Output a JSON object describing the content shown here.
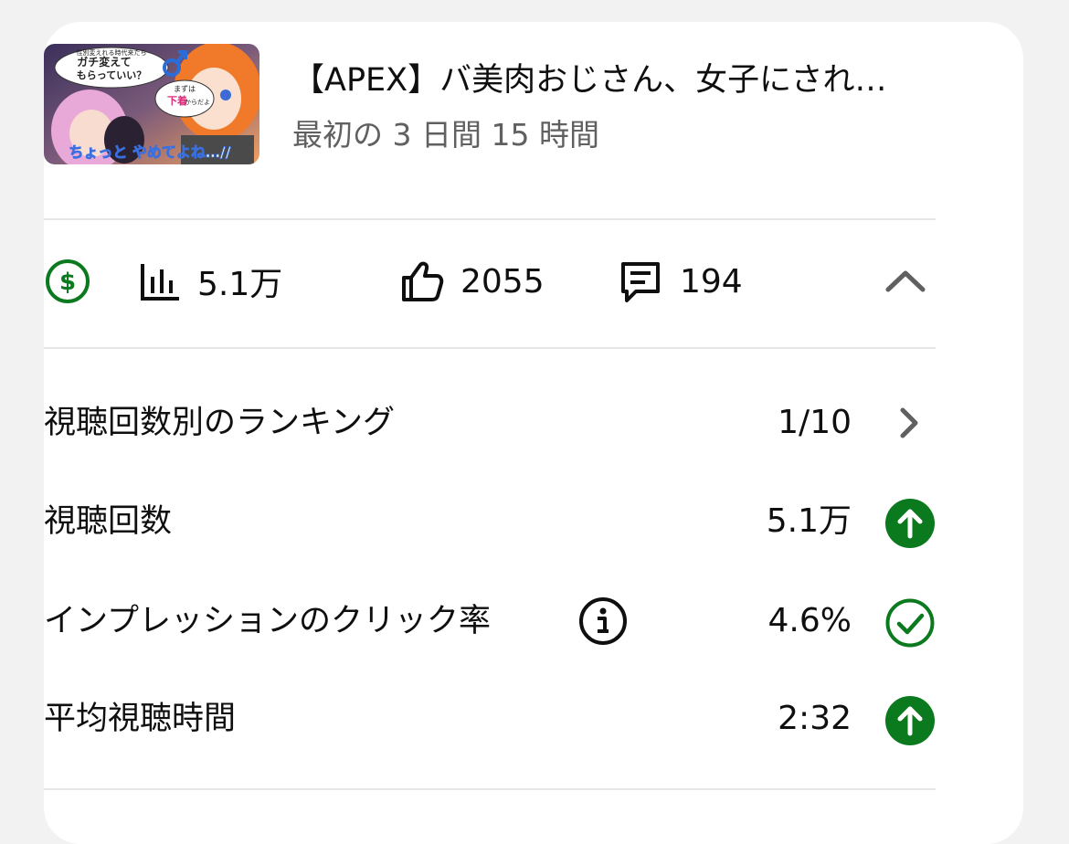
{
  "video": {
    "title": "【APEX】バ美肉おじさん、女子にされ…",
    "period": "最初の 3 日間 15 時間",
    "thumbnail": {
      "caption_top": "性別変えれる時代来たら",
      "caption_mid": "ガチ変えて",
      "caption_mid2": "もらっていい？",
      "caption_right": "まずは",
      "caption_right2": "下着",
      "caption_right3": "からだよ",
      "caption_bottom": "ちょっと やめてよね…//"
    }
  },
  "stats": {
    "monetization_icon": "dollar-circle-icon",
    "views": "5.1万",
    "likes": "2055",
    "comments": "194"
  },
  "metrics": [
    {
      "label": "視聴回数別のランキング",
      "value": "1/10",
      "status_icon": "chevron-right-icon"
    },
    {
      "label": "視聴回数",
      "value": "5.1万",
      "status_icon": "up-arrow-circle-icon"
    },
    {
      "label": "インプレッションのクリック率",
      "value": "4.6%",
      "status_icon": "check-circle-icon"
    },
    {
      "label": "平均視聴時間",
      "value": "2:32",
      "status_icon": "up-arrow-circle-icon"
    }
  ],
  "colors": {
    "positive_green": "#0b7a1f",
    "divider": "#e6e6e6",
    "secondary_text": "#606060"
  }
}
